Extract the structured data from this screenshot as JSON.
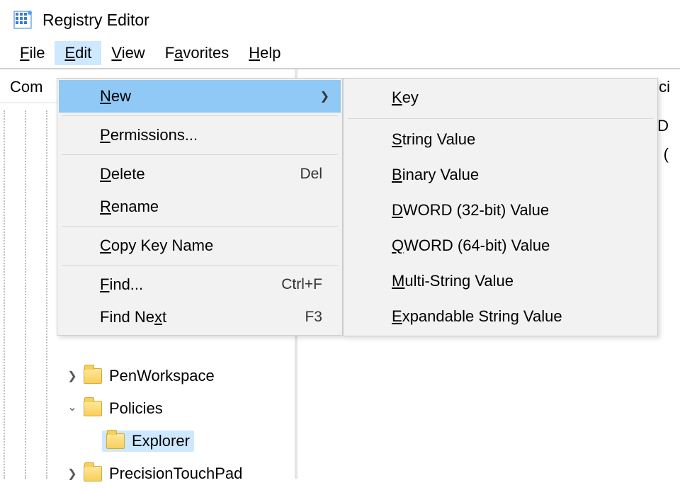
{
  "app": {
    "title": "Registry Editor"
  },
  "menu": {
    "file": {
      "label": "File",
      "ul": "F",
      "rest": "ile"
    },
    "edit": {
      "label": "Edit",
      "ul": "E",
      "rest": "dit"
    },
    "view": {
      "label": "View",
      "ul": "V",
      "rest": "iew"
    },
    "fav": {
      "label": "Favorites",
      "ul": "a",
      "pre": "F",
      "rest": "vorites"
    },
    "help": {
      "label": "Help",
      "ul": "H",
      "rest": "elp"
    }
  },
  "left": {
    "header": "Com"
  },
  "right": {
    "header": "olici",
    "line1": "D",
    "line2": "("
  },
  "tree": {
    "penworkspace": {
      "label": "PenWorkspace"
    },
    "policies": {
      "label": "Policies"
    },
    "explorer": {
      "label": "Explorer"
    },
    "precision": {
      "label": "PrecisionTouchPad"
    }
  },
  "editMenu": {
    "new": {
      "ul": "N",
      "rest": "ew"
    },
    "permissions": {
      "ul": "P",
      "rest": "ermissions..."
    },
    "delete": {
      "ul": "D",
      "rest": "elete",
      "shortcut": "Del"
    },
    "rename": {
      "ul": "R",
      "rest": "ename"
    },
    "copykey": {
      "ul": "C",
      "rest": "opy Key Name"
    },
    "find": {
      "ul": "F",
      "rest": "ind...",
      "shortcut": "Ctrl+F"
    },
    "findnext": {
      "pre": "Find Ne",
      "ul": "x",
      "rest": "t",
      "shortcut": "F3"
    }
  },
  "newMenu": {
    "key": {
      "ul": "K",
      "rest": "ey"
    },
    "string": {
      "ul": "S",
      "rest": "tring Value"
    },
    "binary": {
      "ul": "B",
      "rest": "inary Value"
    },
    "dword": {
      "ul": "D",
      "rest": "WORD (32-bit) Value"
    },
    "qword": {
      "ul": "Q",
      "rest": "WORD (64-bit) Value"
    },
    "multi": {
      "ul": "M",
      "rest": "ulti-String Value"
    },
    "expand": {
      "ul": "E",
      "rest": "xpandable String Value"
    }
  }
}
